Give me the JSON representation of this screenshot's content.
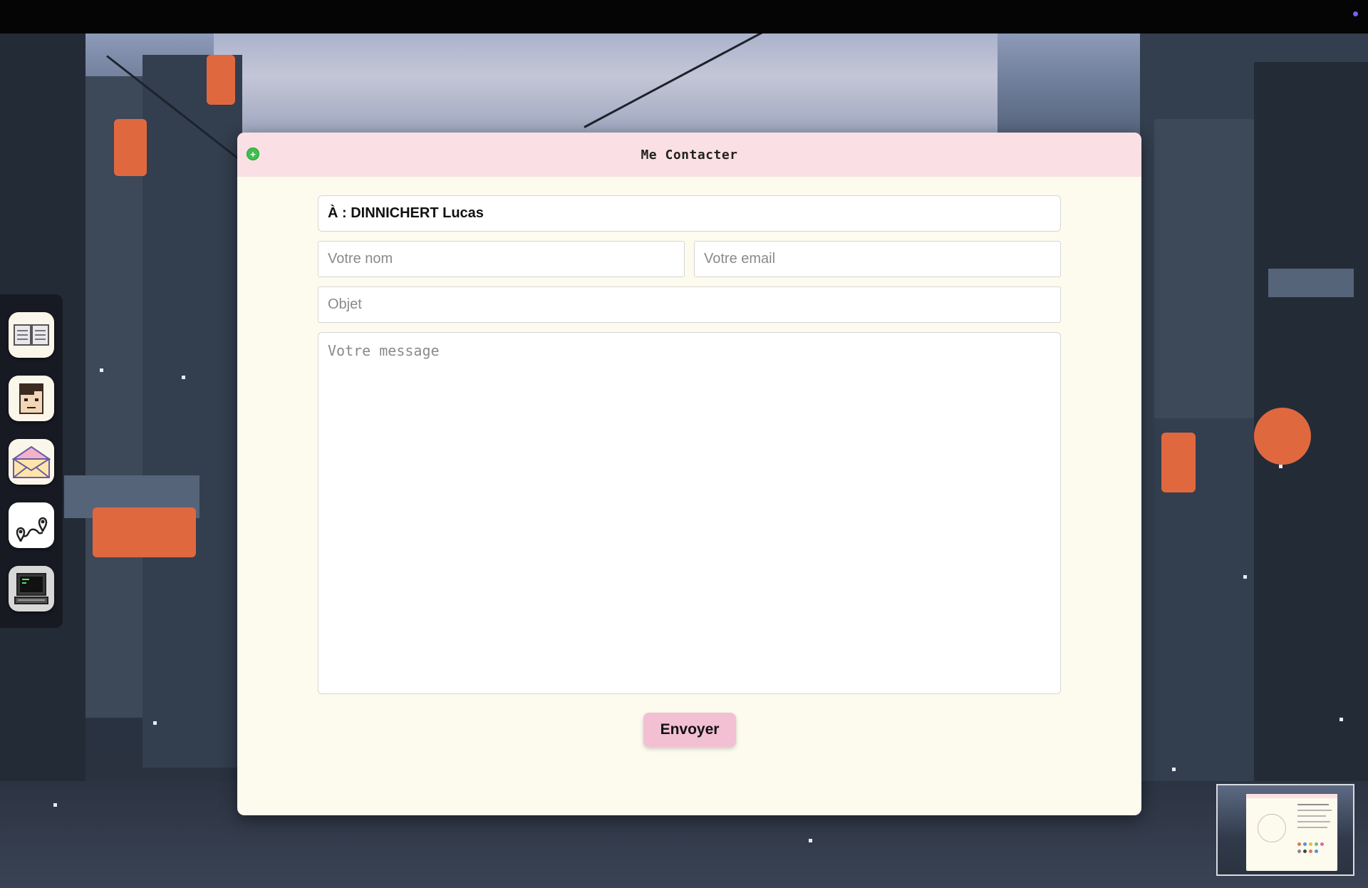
{
  "window": {
    "title": "Me Contacter"
  },
  "form": {
    "recipient": "À : DINNICHERT Lucas",
    "name_placeholder": "Votre nom",
    "email_placeholder": "Votre email",
    "subject_placeholder": "Objet",
    "message_placeholder": "Votre message",
    "send_label": "Envoyer"
  },
  "dock": {
    "apps": [
      {
        "icon": "book-icon"
      },
      {
        "icon": "avatar-icon"
      },
      {
        "icon": "mail-icon"
      },
      {
        "icon": "map-route-icon"
      },
      {
        "icon": "terminal-computer-icon"
      }
    ]
  },
  "colors": {
    "titlebar": "#fae0e4",
    "window_bg": "#fdfaee",
    "send_button": "#f2bfd3",
    "close_button": "#3fbf4e",
    "topbar_indicator": "#7b5cff"
  }
}
